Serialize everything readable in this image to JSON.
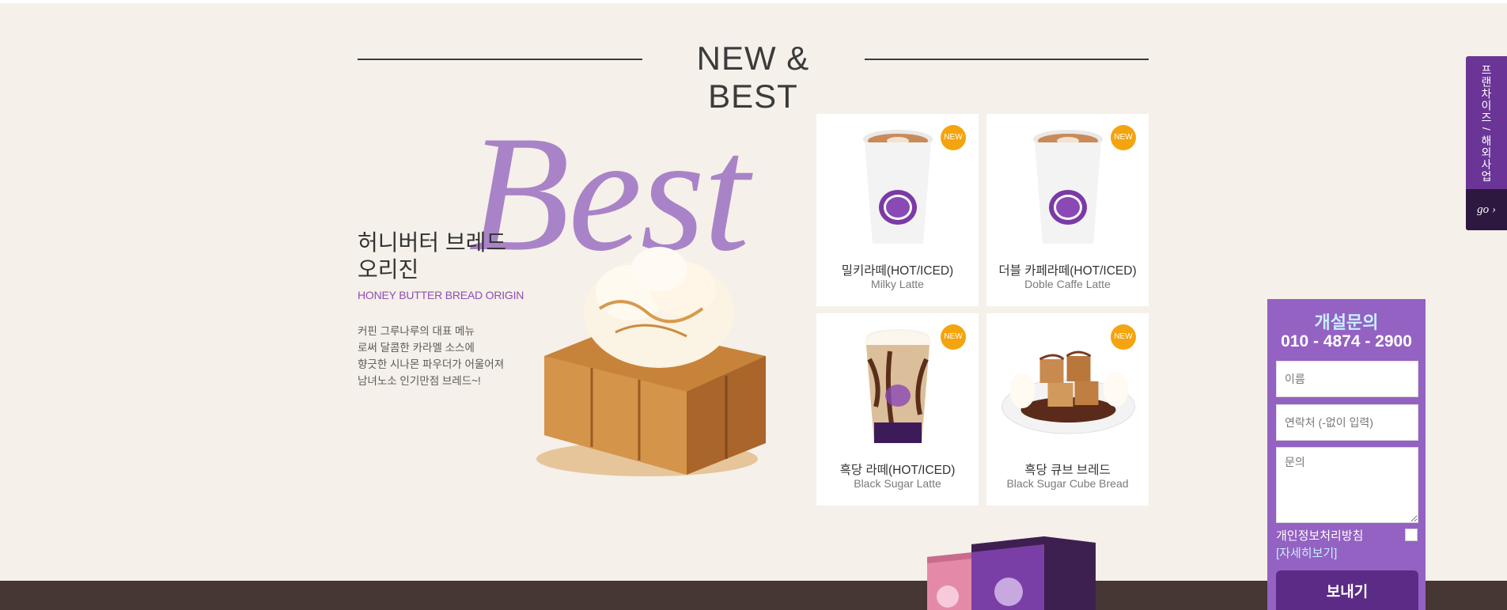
{
  "section": {
    "title": "NEW & BEST",
    "best_word": "Best"
  },
  "feature": {
    "name_line1": "허니버터 브레드",
    "name_line2": "오리진",
    "name_en": "HONEY BUTTER BREAD ORIGIN",
    "desc_lines": [
      "커핀 그루나루의 대표 메뉴",
      "로써 달콤한 카라멜 소스에",
      "향긋한 시나몬 파우더가 어울어져",
      "남녀노소 인기만점 브레드~!"
    ]
  },
  "products": [
    {
      "ko": "밀키라떼(HOT/ICED)",
      "en": "Milky Latte",
      "badge": "NEW",
      "icon": "hot-cup-icon"
    },
    {
      "ko": "더블 카페라떼(HOT/ICED)",
      "en": "Doble Caffe Latte",
      "badge": "NEW",
      "icon": "hot-cup-icon"
    },
    {
      "ko": "흑당 라떼(HOT/ICED)",
      "en": "Black Sugar Latte",
      "badge": "NEW",
      "icon": "iced-cup-icon"
    },
    {
      "ko": "흑당 큐브 브레드",
      "en": "Black Sugar Cube Bread",
      "badge": "NEW",
      "icon": "cube-bread-icon"
    }
  ],
  "side_tab": {
    "label": "프랜차이즈 / 해외사업",
    "go": "go ›"
  },
  "inquiry": {
    "title": "개설문의",
    "phone": "010 - 4874 - 2900",
    "name_placeholder": "이름",
    "phone_placeholder": "연락처 (-없이 입력)",
    "message_placeholder": "문의",
    "privacy_label": "개인정보처리방침",
    "detail_link": "[자세히보기]",
    "submit_label": "보내기"
  },
  "colors": {
    "background": "#f5f0e9",
    "accent_purple": "#9462c2",
    "best_word": "#a983c7",
    "badge": "#f4a40f",
    "footer": "#463634"
  }
}
